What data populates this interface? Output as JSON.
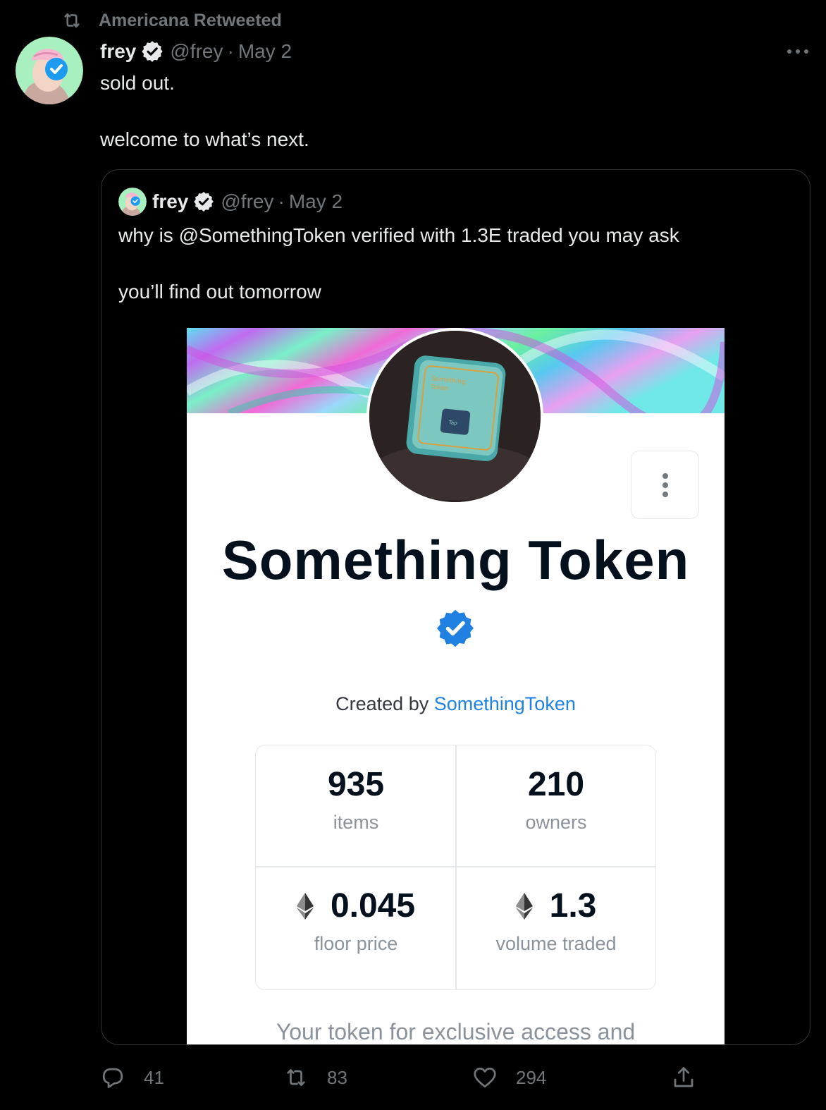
{
  "retweet": {
    "icon": "retweet-icon",
    "label": "Americana Retweeted"
  },
  "tweet": {
    "name": "frey",
    "handle": "@frey",
    "separator": "·",
    "date": "May 2",
    "lines": [
      "sold out.",
      "welcome to what’s next."
    ]
  },
  "quote": {
    "name": "frey",
    "handle": "@frey",
    "separator": "·",
    "date": "May 2",
    "lines": [
      "why is @SomethingToken verified with 1.3E traded you may ask",
      "you’ll find out tomorrow"
    ],
    "card": {
      "title": "Something Token",
      "avatar_text": [
        "Something",
        "Token",
        "Tap"
      ],
      "created_prefix": "Created by ",
      "created_link": "SomethingToken",
      "stats": [
        {
          "value": "935",
          "label": "items"
        },
        {
          "value": "210",
          "label": "owners"
        },
        {
          "value": "0.045",
          "label": "floor price"
        },
        {
          "value": "1.3",
          "label": "volume traded"
        }
      ],
      "description": "Your token for exclusive access and"
    }
  },
  "actions": {
    "reply_count": "41",
    "retweet_count": "83",
    "like_count": "294"
  },
  "colors": {
    "background": "#000000",
    "text": "#e7e9ea",
    "muted": "#71767b",
    "verified": "#1d9bf0",
    "link": "#2081e2",
    "card_title": "#04111d"
  }
}
